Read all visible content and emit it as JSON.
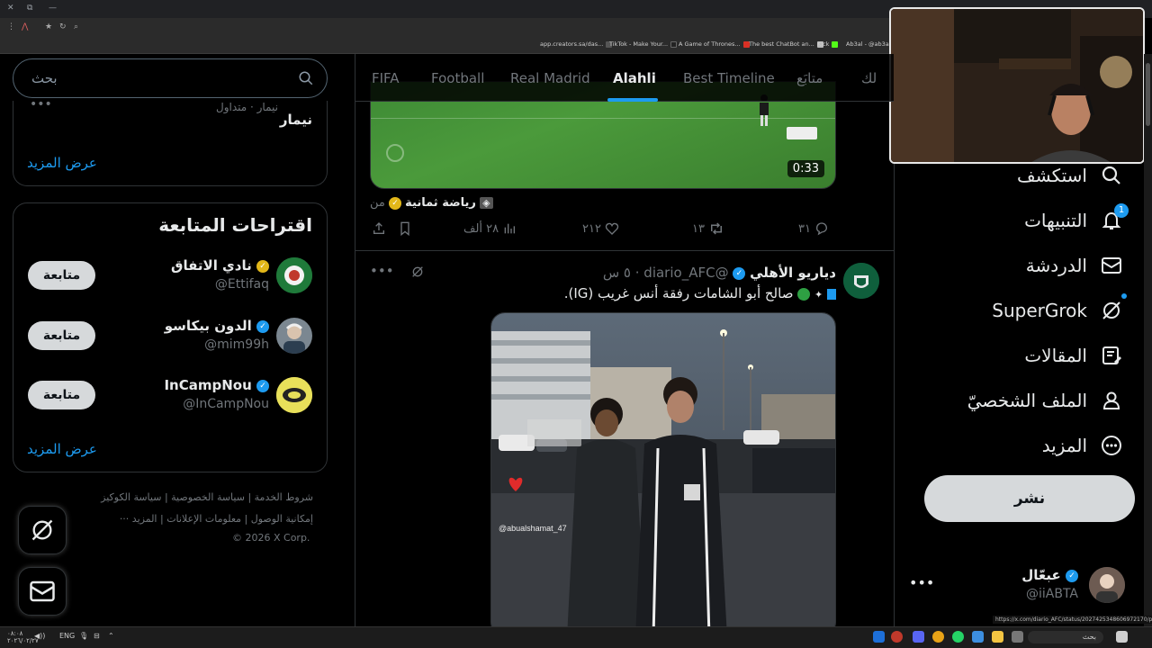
{
  "browser": {
    "bookmarks": [
      {
        "label": "app.creators.sa/das...",
        "color": "#555555"
      },
      {
        "label": "TikTok - Make Your...",
        "color": "#222222"
      },
      {
        "label": "A Game of Thrones...",
        "color": "#333333"
      },
      {
        "label": "The best ChatBot an...",
        "color": "#d93025"
      },
      {
        "label": "Kick",
        "color": "#53fc18"
      },
      {
        "label": "Ab3al - @ab3al |",
        "color": "#1d9bf0"
      }
    ]
  },
  "search": {
    "placeholder": "بحث"
  },
  "trend": {
    "meta": "نيمار · متداول",
    "name": "نيمار",
    "show_more": "عرض المزيد"
  },
  "who_to_follow": {
    "title": "اقتراحات المتابعة",
    "items": [
      {
        "name": "نادي الاتفاق",
        "handle": "@Ettifaq",
        "follow": "متابعة",
        "badge": "gold"
      },
      {
        "name": "الدون بيكاسو",
        "handle": "@mim99h",
        "follow": "متابعة",
        "badge": "blue"
      },
      {
        "name": "InCampNou",
        "handle": "@InCampNou",
        "follow": "متابعة",
        "badge": "blue"
      }
    ],
    "show_more": "عرض المزيد"
  },
  "footer": {
    "row1": [
      "شروط الخدمة",
      "سياسة الخصوصية",
      "سياسة الكوكيز"
    ],
    "row2": [
      "إمكانية الوصول",
      "معلومات الإعلانات",
      "المزيد ···"
    ],
    "copyright": "© 2026 X Corp."
  },
  "tabs": [
    {
      "label": "لك",
      "active": false
    },
    {
      "label": "متابَع",
      "active": false
    },
    {
      "label": "Best Timeline",
      "active": false
    },
    {
      "label": "Alahli",
      "active": true
    },
    {
      "label": "Real Madrid",
      "active": false
    },
    {
      "label": "Football",
      "active": false
    },
    {
      "label": "FIFA",
      "active": false
    }
  ],
  "video_post": {
    "duration": "0:33",
    "source_prefix": "من",
    "source_name": "رياضة ثمانية",
    "actions": {
      "replies": "٣١",
      "reposts": "١٣",
      "likes": "٢١٢",
      "views": "٢٨ ألف"
    }
  },
  "post": {
    "name": "دياريو الأهلي",
    "handle": "@diario_AFC",
    "time": "٥ س",
    "text": "صالح أبو الشامات رفقة أنس غريب (IG).",
    "watermark": "@abualshamat_47"
  },
  "nav": [
    {
      "label": "استكشف",
      "icon": "search-icon"
    },
    {
      "label": "التنبيهات",
      "icon": "bell-icon",
      "badge": "1"
    },
    {
      "label": "الدردشة",
      "icon": "mail-icon"
    },
    {
      "label": "SuperGrok",
      "icon": "grok-icon"
    },
    {
      "label": "المقالات",
      "icon": "article-icon"
    },
    {
      "label": "الملف الشخصيّ",
      "icon": "person-icon"
    },
    {
      "label": "المزيد",
      "icon": "more-circle-icon"
    }
  ],
  "post_button": "نشر",
  "account": {
    "name": "عبعّال",
    "handle": "@iiABTA"
  },
  "status_url": "https://x.com/diario_AFC/status/2027425348606972170/photo/1",
  "taskbar": {
    "lang": "ENG",
    "time": "٠٨:٠٨",
    "date": "٢٠٢٦/٠٢/٢٧",
    "search": "بحث"
  },
  "colors": {
    "accent": "#1d9bf0",
    "background": "#000000",
    "border": "#2f3336",
    "muted": "#71767b"
  }
}
